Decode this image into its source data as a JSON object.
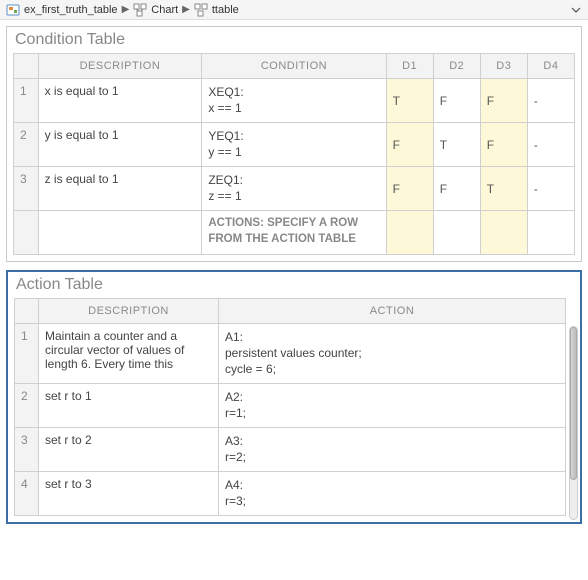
{
  "breadcrumb": {
    "items": [
      {
        "label": "ex_first_truth_table",
        "icon": "model-icon"
      },
      {
        "label": "Chart",
        "icon": "chart-icon"
      },
      {
        "label": "ttable",
        "icon": "ttable-icon"
      }
    ]
  },
  "condition_panel": {
    "title": "Condition Table",
    "headers": {
      "desc": "DESCRIPTION",
      "cond": "CONDITION",
      "d1": "D1",
      "d2": "D2",
      "d3": "D3",
      "d4": "D4"
    },
    "rows": [
      {
        "num": "1",
        "desc": "x is equal to 1",
        "cond": "XEQ1:\nx == 1",
        "d": [
          "T",
          "F",
          "F",
          "-"
        ],
        "hl": [
          true,
          false,
          true,
          false
        ]
      },
      {
        "num": "2",
        "desc": "y is equal to 1",
        "cond": "YEQ1:\ny == 1",
        "d": [
          "F",
          "T",
          "F",
          "-"
        ],
        "hl": [
          true,
          false,
          true,
          false
        ]
      },
      {
        "num": "3",
        "desc": "z is equal to 1",
        "cond": "ZEQ1:\nz == 1",
        "d": [
          "F",
          "F",
          "T",
          "-"
        ],
        "hl": [
          true,
          false,
          true,
          false
        ]
      }
    ],
    "actions_label": "ACTIONS: SPECIFY A ROW FROM THE ACTION TABLE",
    "actions_hl": [
      true,
      false,
      true,
      false
    ]
  },
  "action_panel": {
    "title": "Action Table",
    "headers": {
      "desc": "DESCRIPTION",
      "act": "ACTION"
    },
    "rows": [
      {
        "num": "1",
        "desc": "Maintain a counter and a circular vector of values of length 6. Every time this",
        "act": "A1:\npersistent values counter;\ncycle = 6;"
      },
      {
        "num": "2",
        "desc": "set r to 1",
        "act": "A2:\nr=1;"
      },
      {
        "num": "3",
        "desc": "set r to 2",
        "act": "A3:\nr=2;"
      },
      {
        "num": "4",
        "desc": "set r to 3",
        "act": "A4:\nr=3;"
      }
    ]
  }
}
